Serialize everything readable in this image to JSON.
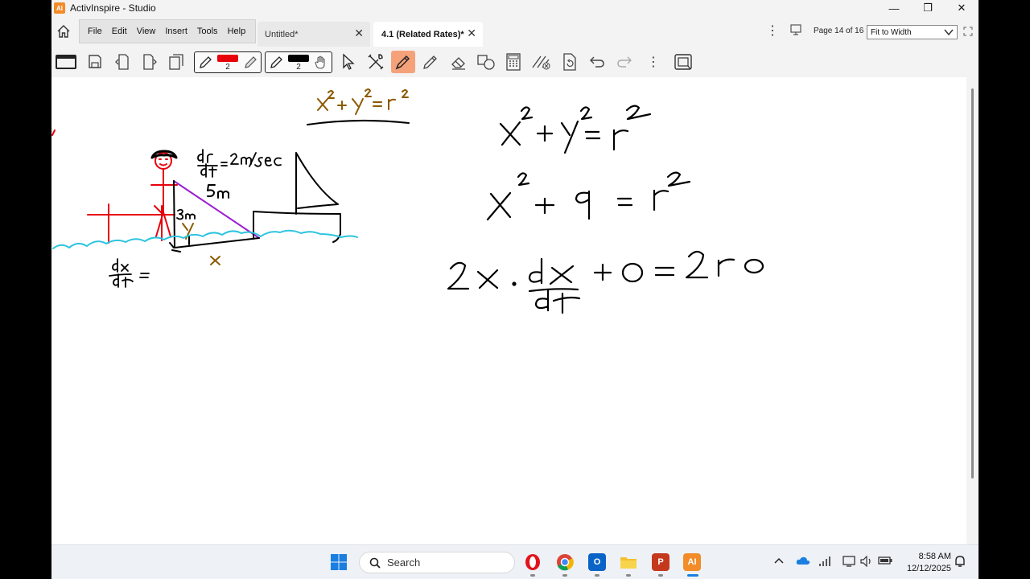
{
  "window": {
    "app_icon": "AI",
    "title": "ActivInspire - Studio",
    "minimize": "—",
    "restore": "❐",
    "close": "✕"
  },
  "menu": {
    "items": [
      "File",
      "Edit",
      "View",
      "Insert",
      "Tools",
      "Help"
    ]
  },
  "tabs": [
    {
      "label": "Untitled*",
      "active": false
    },
    {
      "label": "4.1 (Related Rates)*",
      "active": true
    }
  ],
  "tab_close": "✕",
  "page_counter": "Page 14 of 16",
  "zoom": {
    "selected": "Fit to Width"
  },
  "kebab": "⋮",
  "toolbar": {
    "pen1": {
      "color": "#e8000b",
      "width": "2"
    },
    "pen2": {
      "color": "#000000",
      "width": "2"
    },
    "active_tool": "highlighter-icon",
    "accent": "#f5a27a"
  },
  "taskbar": {
    "search_label": "Search",
    "time": "8:58 AM",
    "date": "12/12/2025",
    "apps": [
      "windows-start-icon",
      "opera-icon",
      "chrome-icon",
      "outlook-icon",
      "file-explorer-icon",
      "powerpoint-icon",
      "activinspire-icon"
    ]
  },
  "canvas": {
    "ink_colors": {
      "black": "#000000",
      "red": "#e8000b",
      "brown": "#8b5a00",
      "purple": "#9b1fd1",
      "cyan": "#2ec4e0"
    }
  }
}
